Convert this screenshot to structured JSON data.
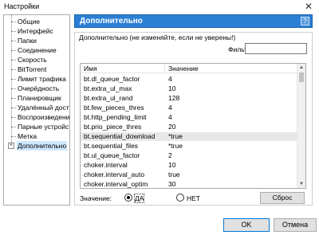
{
  "window": {
    "title": "Настройки",
    "close_glyph": "✕"
  },
  "sidebar": {
    "items": [
      {
        "label": "Общие"
      },
      {
        "label": "Интерфейс"
      },
      {
        "label": "Папки"
      },
      {
        "label": "Соединение"
      },
      {
        "label": "Скорость"
      },
      {
        "label": "BitTorrent"
      },
      {
        "label": "Лимит трафика"
      },
      {
        "label": "Очерёдность"
      },
      {
        "label": "Планировщик"
      },
      {
        "label": "Удалённый доступ"
      },
      {
        "label": "Воспроизведение"
      },
      {
        "label": "Парные устройства"
      },
      {
        "label": "Метка"
      },
      {
        "label": "Дополнительно",
        "selected": true,
        "expander": "+"
      }
    ]
  },
  "panel": {
    "header": "Дополнительно",
    "help_glyph": "?",
    "group_title": "Дополнительно (не изменяйте, если не уверены!)",
    "filter_label": "Фильт",
    "filter_value": ""
  },
  "table": {
    "columns": {
      "name": "Имя",
      "value": "Значение"
    },
    "rows": [
      {
        "name": "bt.dl_queue_factor",
        "value": "4"
      },
      {
        "name": "bt.extra_ul_max",
        "value": "10"
      },
      {
        "name": "bt.extra_ul_rand",
        "value": "128"
      },
      {
        "name": "bt.few_pieces_thres",
        "value": "4"
      },
      {
        "name": "bt.http_pending_limit",
        "value": "4"
      },
      {
        "name": "bt.prio_piece_thres",
        "value": "20"
      },
      {
        "name": "bt.sequential_download",
        "value": "*true",
        "selected": true
      },
      {
        "name": "bt.sequential_files",
        "value": "*true"
      },
      {
        "name": "bt.ul_queue_factor",
        "value": "2"
      },
      {
        "name": "choker.interval",
        "value": "10"
      },
      {
        "name": "choker.interval_auto",
        "value": "true"
      },
      {
        "name": "choker.interval_optim",
        "value": "30"
      }
    ]
  },
  "value_editor": {
    "label": "Значение:",
    "option_yes": "ДА",
    "option_no": "НЕТ",
    "selected": "yes",
    "reset_label": "Сброс"
  },
  "footer": {
    "ok_label": "OK",
    "cancel_label": "Отмена"
  },
  "colors": {
    "header_bg": "#2b7fd4",
    "selection_bg": "#cde8ff"
  }
}
